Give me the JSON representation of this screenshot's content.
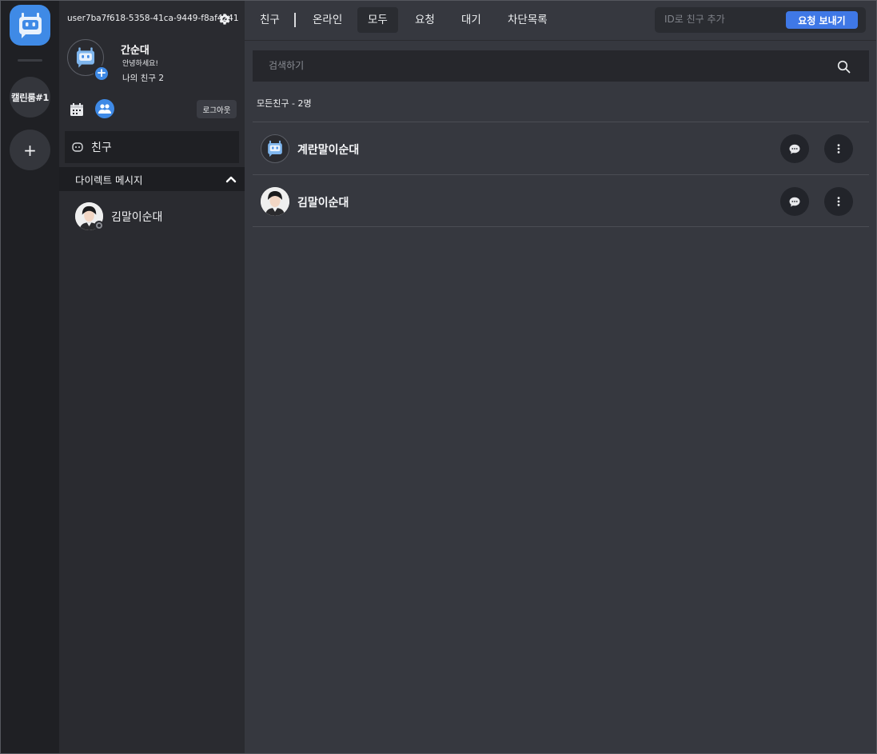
{
  "rail": {
    "servers": [
      {
        "label": "캘린룸#1"
      },
      {
        "label": "+"
      }
    ]
  },
  "sidebar": {
    "user_id": "user7ba7f618-5358-41ca-9449-f8af4241",
    "profile": {
      "name": "간순대",
      "status": "안녕하세요!",
      "friends": "나의 친구 2"
    },
    "logout_label": "로그아웃",
    "nav_friends_label": "친구",
    "dm_header": "다이렉트 메시지",
    "dms": [
      {
        "name": "김말이순대"
      }
    ]
  },
  "topbar": {
    "title": "친구",
    "tabs": [
      {
        "label": "온라인"
      },
      {
        "label": "모두"
      },
      {
        "label": "요청"
      },
      {
        "label": "대기"
      },
      {
        "label": "차단목록"
      }
    ],
    "active_tab": "모두",
    "add_placeholder": "ID로 친구 추가",
    "send_label": "요청 보내기"
  },
  "main": {
    "search_placeholder": "검색하기",
    "count_label": "모든친구 - 2명",
    "friends": [
      {
        "name": "계란말이순대",
        "avatar": "bot-icon"
      },
      {
        "name": "김말이순대",
        "avatar": "person-photo"
      }
    ]
  },
  "colors": {
    "accent": "#3f8ae6",
    "background": "#36383f",
    "sidebar": "#2a2b30",
    "rail": "#1f2024"
  }
}
